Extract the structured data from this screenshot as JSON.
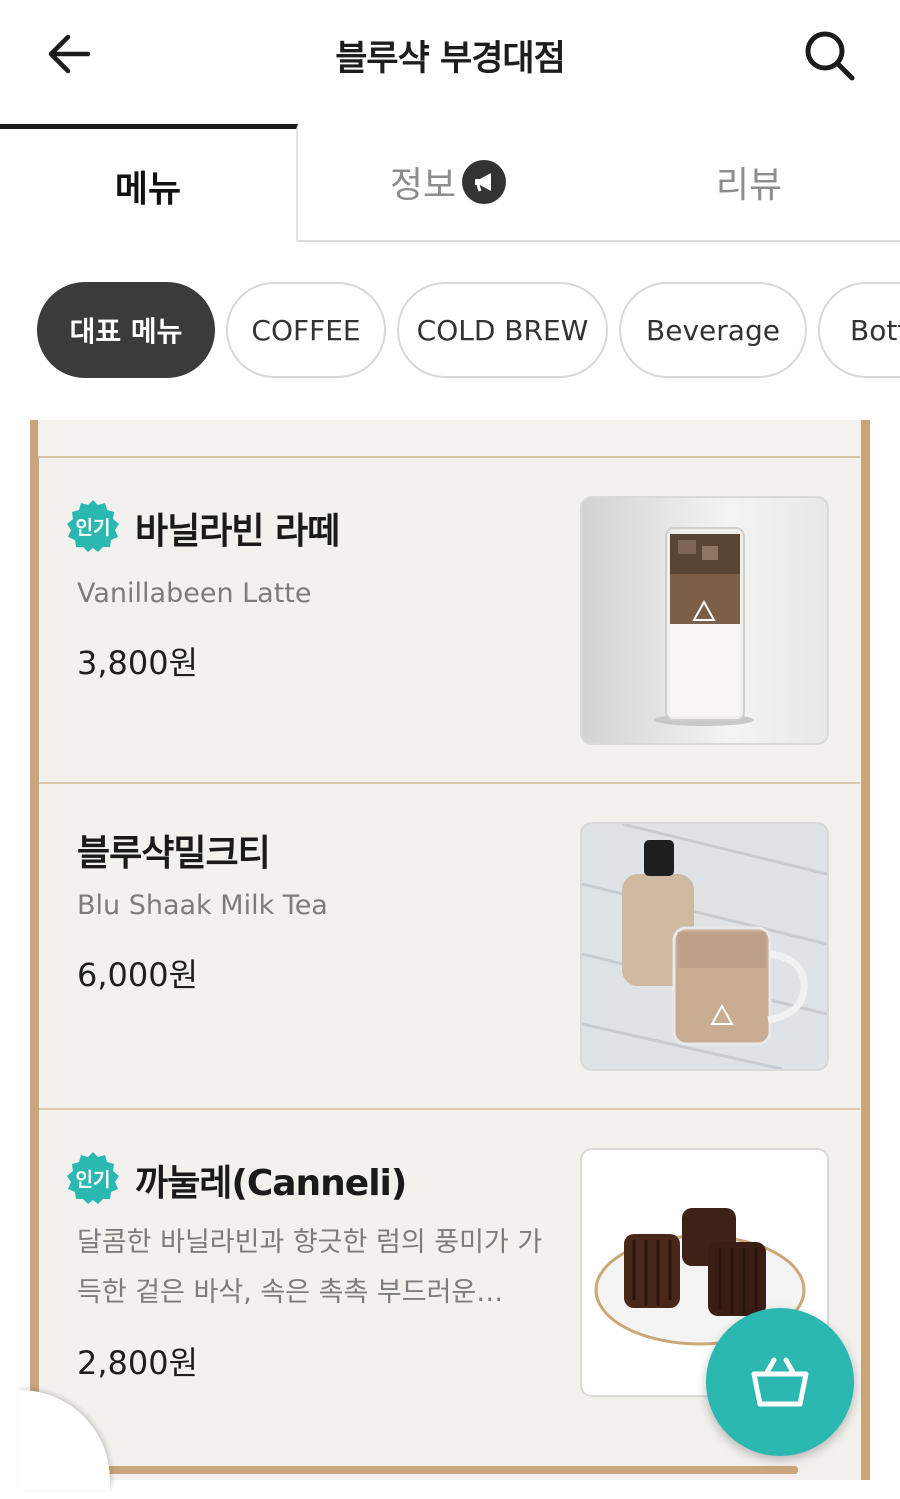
{
  "header": {
    "title": "블루샥 부경대점"
  },
  "tabs": [
    {
      "label": "메뉴"
    },
    {
      "label": "정보"
    },
    {
      "label": "리뷰"
    }
  ],
  "categories": [
    {
      "label": "대표 메뉴"
    },
    {
      "label": "COFFEE"
    },
    {
      "label": "COLD BREW"
    },
    {
      "label": "Beverage"
    },
    {
      "label": "Bottle"
    }
  ],
  "menu_items": [
    {
      "badge": "인기",
      "name": "바닐라빈 라떼",
      "english": "Vanillabeen Latte",
      "price": "3,800원"
    },
    {
      "name": "블루샥밀크티",
      "english": "Blu Shaak Milk Tea",
      "price": "6,000원"
    },
    {
      "badge": "인기",
      "name": "까눌레(Canneli)",
      "description": "달콤한 바닐라빈과 향긋한 럼의 풍미가 가득한 겉은 바삭, 속은 촉촉 부드러운…",
      "price": "2,800원"
    }
  ],
  "colors": {
    "accent": "#2bb8b0",
    "active_chip": "#3b3b3b",
    "board_frame": "#c8a57a"
  },
  "icons": {
    "back": "arrow-left-icon",
    "search": "search-icon",
    "info": "megaphone-icon",
    "cart": "basket-icon"
  }
}
